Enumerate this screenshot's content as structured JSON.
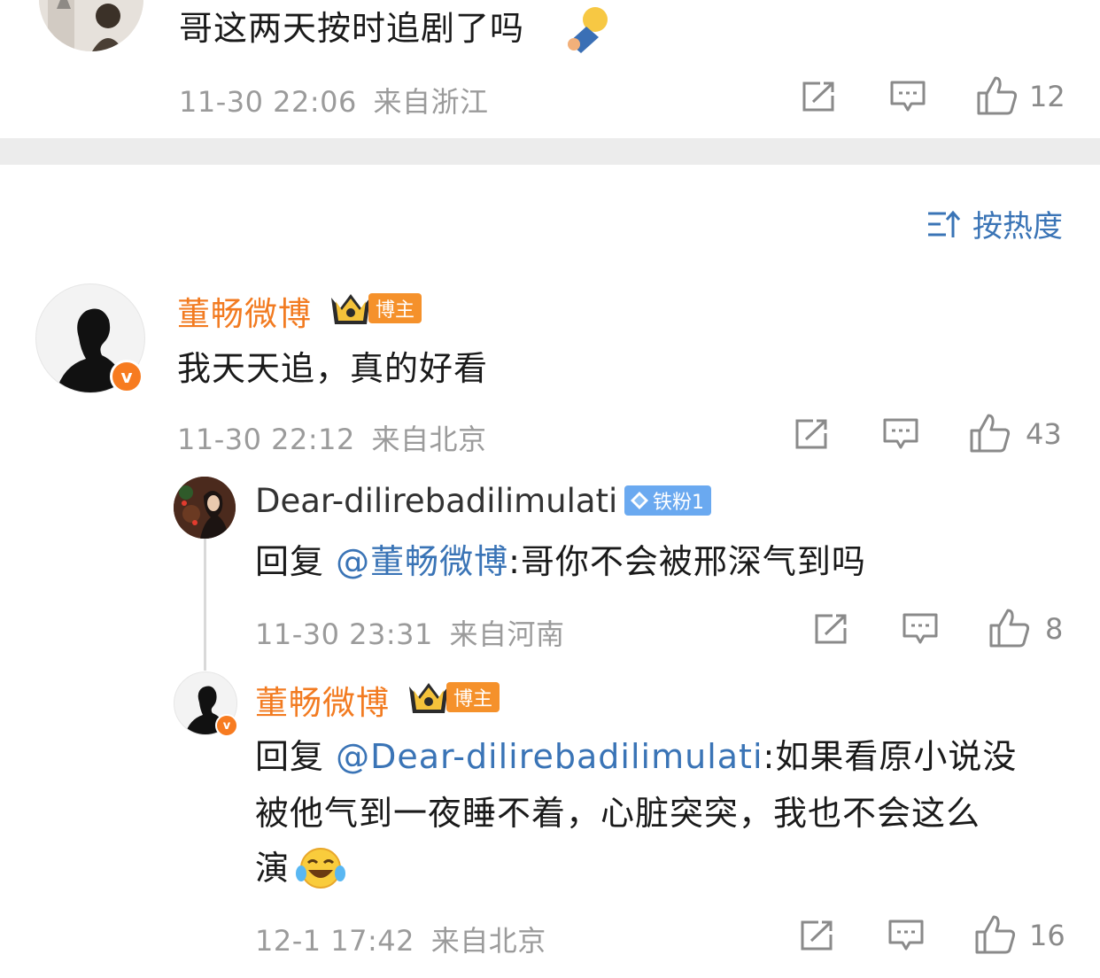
{
  "top_comment": {
    "text": "哥这两天按时追剧了吗",
    "emoji": "sleepy-emoji",
    "time": "11-30 22:06",
    "location": "来自浙江",
    "likes": "12"
  },
  "sort": {
    "label": "按热度",
    "icon": "sort-icon"
  },
  "main_comment": {
    "author": "董畅微博",
    "badge": "博主",
    "text": "我天天追，真的好看",
    "time": "11-30 22:12",
    "location": "来自北京",
    "likes": "43"
  },
  "replies": [
    {
      "author": "Dear-dilirebadilimulati",
      "badge": "铁粉1",
      "reply_prefix": "回复",
      "mention": "@董畅微博",
      "text": ":哥你不会被邢深气到吗",
      "time": "11-30 23:31",
      "location": "来自河南",
      "likes": "8"
    },
    {
      "author": "董畅微博",
      "badge": "博主",
      "reply_prefix": "回复",
      "mention": "@Dear-dilirebadilimulati",
      "text_line1": ":如果看原小说没",
      "text_line2": "被他气到一夜睡不着，心脏突突，我也不会这么",
      "text_line3": "演",
      "emoji": "laughing-crying-emoji",
      "time": "12-1 17:42",
      "location": "来自北京",
      "likes": "16"
    }
  ],
  "colors": {
    "accent_orange": "#f27b21",
    "link_blue": "#3a74b6",
    "meta_gray": "#9b9b9b"
  }
}
